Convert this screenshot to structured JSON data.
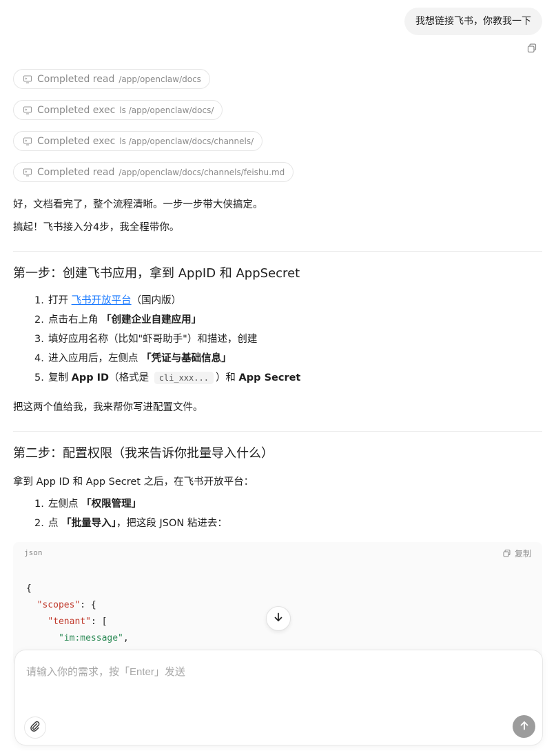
{
  "user_message": {
    "text": "我想链接飞书，你教我一下"
  },
  "tool_calls": [
    {
      "status": "Completed read",
      "path": "/app/openclaw/docs"
    },
    {
      "status": "Completed exec",
      "path": "ls /app/openclaw/docs/"
    },
    {
      "status": "Completed exec",
      "path": "ls /app/openclaw/docs/channels/"
    },
    {
      "status": "Completed read",
      "path": "/app/openclaw/docs/channels/feishu.md"
    }
  ],
  "intro": [
    "好，文档看完了，整个流程清晰。一步一步带大侠搞定。",
    "搞起！飞书接入分4步，我全程带你。"
  ],
  "step1": {
    "heading": "第一步：创建飞书应用，拿到 AppID 和 AppSecret",
    "items": [
      {
        "num": "1.",
        "pre": "打开 ",
        "link": "飞书开放平台",
        "post": "（国内版）"
      },
      {
        "num": "2.",
        "pre": "点击右上角 ",
        "bold": "「创建企业自建应用」"
      },
      {
        "num": "3.",
        "text": "填好应用名称（比如\"虾哥助手\"）和描述，创建"
      },
      {
        "num": "4.",
        "pre": "进入应用后，左侧点 ",
        "bold": "「凭证与基础信息」"
      },
      {
        "num": "5.",
        "pre": "复制 ",
        "bold1": "App ID",
        "mid1": "（格式是 ",
        "code": "cli_xxx...",
        "mid2": "）和 ",
        "bold2": "App Secret"
      }
    ],
    "outro": "把这两个值给我，我来帮你写进配置文件。"
  },
  "step2": {
    "heading": "第二步：配置权限（我来告诉你批量导入什么）",
    "lead": "拿到 App ID 和 App Secret 之后，在飞书开放平台：",
    "items": [
      {
        "num": "1.",
        "pre": "左侧点 ",
        "bold": "「权限管理」"
      },
      {
        "num": "2.",
        "pre": "点 ",
        "bold": "「批量导入」",
        "post": "，把这段 JSON 粘进去："
      }
    ]
  },
  "code_block": {
    "lang": "json",
    "copy_label": "复制",
    "lines": [
      {
        "indent": "",
        "parts": [
          {
            "t": "{",
            "c": "punc"
          }
        ]
      },
      {
        "indent": "  ",
        "parts": [
          {
            "t": "\"scopes\"",
            "c": "key"
          },
          {
            "t": ": {",
            "c": "punc"
          }
        ]
      },
      {
        "indent": "    ",
        "parts": [
          {
            "t": "\"tenant\"",
            "c": "key"
          },
          {
            "t": ": [",
            "c": "punc"
          }
        ]
      },
      {
        "indent": "      ",
        "parts": [
          {
            "t": "\"im:message\"",
            "c": "str"
          },
          {
            "t": ",",
            "c": "punc"
          }
        ]
      }
    ]
  },
  "composer": {
    "placeholder": "请输入你的需求，按「Enter」发送"
  }
}
